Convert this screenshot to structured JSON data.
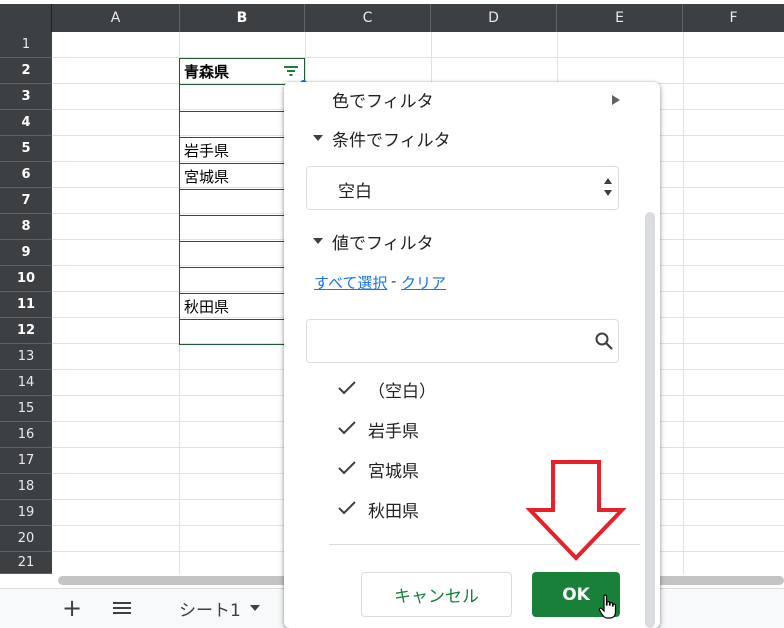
{
  "columns": [
    "A",
    "B",
    "C",
    "D",
    "E",
    "F"
  ],
  "rows": [
    "1",
    "2",
    "3",
    "4",
    "5",
    "6",
    "7",
    "8",
    "9",
    "10",
    "11",
    "12",
    "13",
    "14",
    "15",
    "16",
    "17",
    "18",
    "19",
    "20",
    "21"
  ],
  "cells": {
    "B2": "青森県",
    "B5": "岩手県",
    "B6": "宮城県",
    "B11": "秋田県"
  },
  "sheet_tab": "シート1",
  "filter_panel": {
    "filter_by_color": "色でフィルタ",
    "filter_by_condition": "条件でフィルタ",
    "condition_value": "空白",
    "filter_by_values": "値でフィルタ",
    "select_all": "すべて選択",
    "separator": "-",
    "clear": "クリア",
    "search_placeholder": "",
    "values": [
      "（空白）",
      "岩手県",
      "宮城県",
      "秋田県"
    ],
    "cancel_label": "キャンセル",
    "ok_label": "OK"
  },
  "colors": {
    "header_bg": "#3c4043",
    "accent_green": "#188038",
    "link_blue": "#1a73e8",
    "annotation_red": "#e8202a"
  },
  "icons": [
    "filter-icon",
    "triangle-right-icon",
    "triangle-down-icon",
    "search-icon",
    "check-icon",
    "plus-icon",
    "menu-icon",
    "caret-down-icon",
    "red-arrow-down-annotation",
    "hand-cursor-icon"
  ]
}
